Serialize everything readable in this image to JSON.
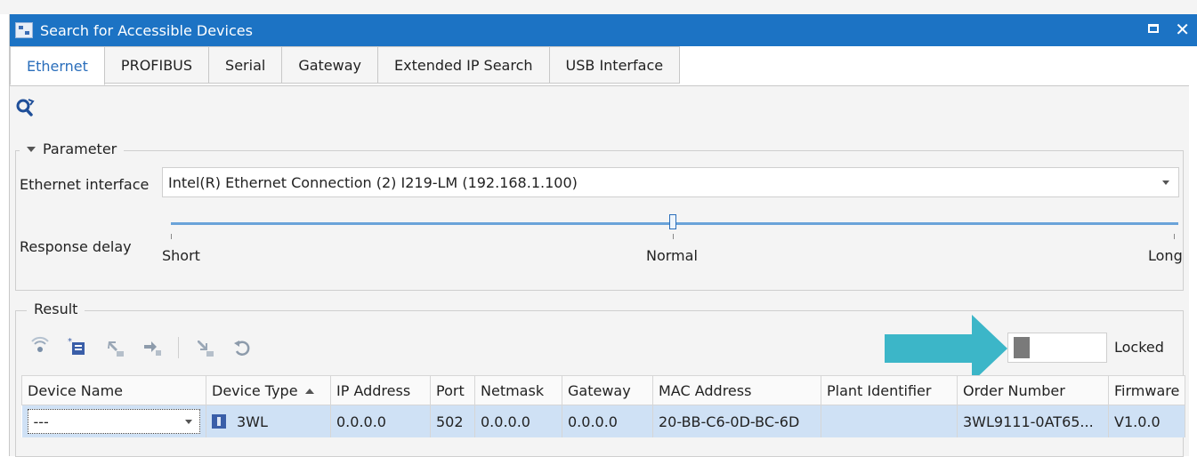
{
  "window": {
    "title": "Search for Accessible Devices",
    "maximize_icon": "maximize-icon",
    "close_icon": "close-icon"
  },
  "tabs": [
    {
      "label": "Ethernet",
      "active": true
    },
    {
      "label": "PROFIBUS"
    },
    {
      "label": "Serial"
    },
    {
      "label": "Gateway"
    },
    {
      "label": "Extended IP Search"
    },
    {
      "label": "USB Interface"
    }
  ],
  "toolbar": {
    "search_icon": "search-refresh-icon"
  },
  "parameter": {
    "legend": "Parameter",
    "ethernet_label": "Ethernet interface",
    "ethernet_value": "Intel(R) Ethernet Connection (2) I219-LM (192.168.1.100)",
    "response_label": "Response delay",
    "scale": {
      "short": "Short",
      "normal": "Normal",
      "long": "Long"
    },
    "response_level": 0.5
  },
  "result": {
    "legend": "Result",
    "toolbar_icons": [
      "scan-device-icon",
      "add-device-icon",
      "upload-icon",
      "transfer-icon",
      "download-icon",
      "undo-icon"
    ],
    "locked_label": "Locked",
    "locked_on": false,
    "columns": [
      "Device Name",
      "Device Type",
      "IP Address",
      "Port",
      "Netmask",
      "Gateway",
      "MAC Address",
      "Plant Identifier",
      "Order Number",
      "Firmware"
    ],
    "rows": [
      {
        "device_name": "---",
        "device_type": "3WL",
        "ip": "0.0.0.0",
        "port": "502",
        "netmask": "0.0.0.0",
        "gateway": "0.0.0.0",
        "mac": "20-BB-C6-0D-BC-6D",
        "plant": "",
        "order": "3WL9111-0AT65...",
        "firmware": "V1.0.0"
      }
    ]
  },
  "colors": {
    "titlebar": "#1c73c4",
    "active_tab_text": "#2a6ebb",
    "selected_row": "#cfe1f5",
    "annotation_arrow": "#3cb6c8"
  }
}
